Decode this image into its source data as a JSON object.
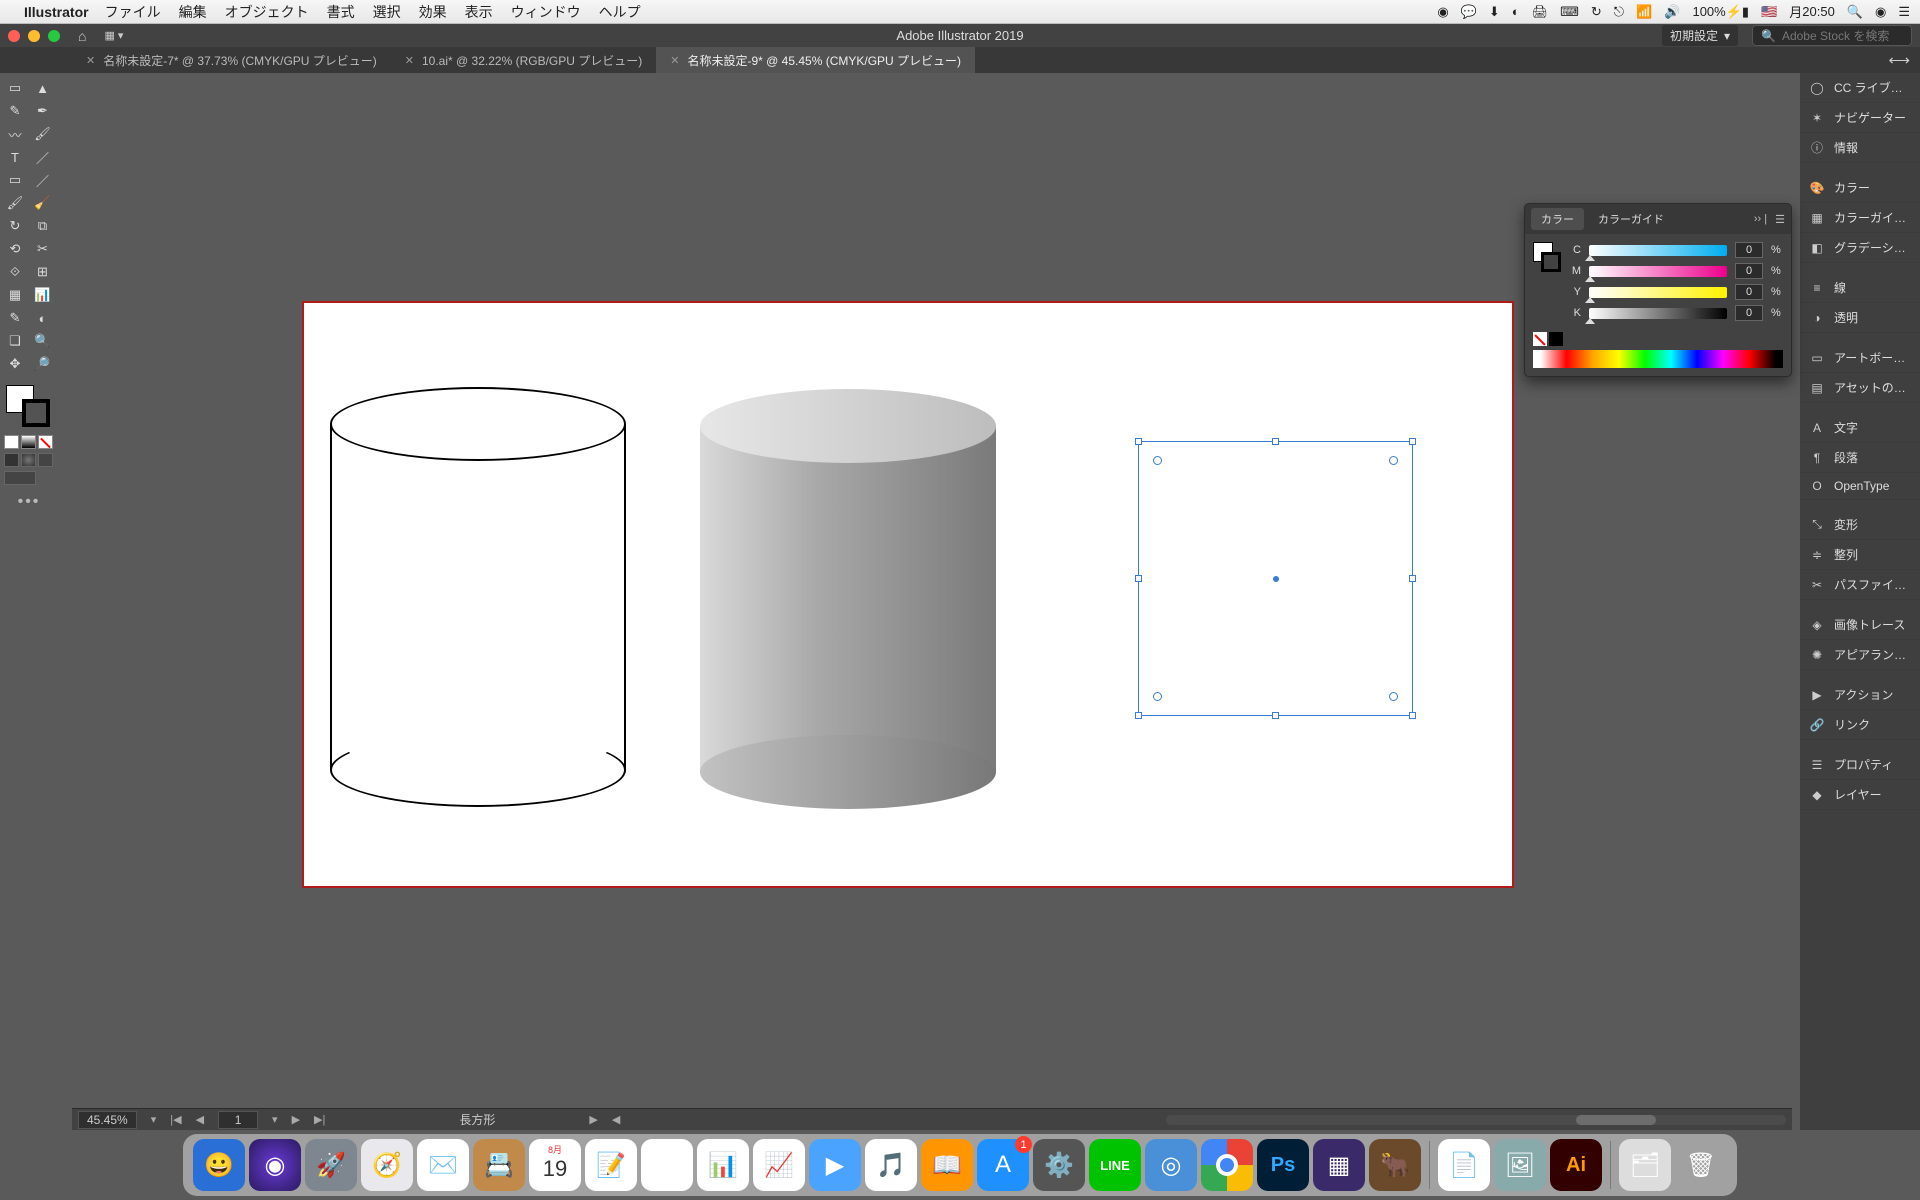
{
  "menubar": {
    "app": "Illustrator",
    "items": [
      "ファイル",
      "編集",
      "オブジェクト",
      "書式",
      "選択",
      "効果",
      "表示",
      "ウィンドウ",
      "ヘルプ"
    ],
    "battery": "100%",
    "lang": "🇺🇸",
    "day": "月",
    "time": "20:50"
  },
  "appstrip": {
    "title": "Adobe Illustrator 2019",
    "workspace": "初期設定",
    "search_placeholder": "Adobe Stock を検索"
  },
  "tabs": [
    {
      "label": "名称未設定-7* @ 37.73% (CMYK/GPU プレビュー)",
      "active": false
    },
    {
      "label": "10.ai* @ 32.22% (RGB/GPU プレビュー)",
      "active": false
    },
    {
      "label": "名称未設定-9* @ 45.45% (CMYK/GPU プレビュー)",
      "active": true
    }
  ],
  "status": {
    "zoom": "45.45%",
    "artboard_nav": "1",
    "object": "長方形"
  },
  "color_panel": {
    "tab_color": "カラー",
    "tab_guide": "カラーガイド",
    "channels": [
      {
        "l": "C",
        "v": "0"
      },
      {
        "l": "M",
        "v": "0"
      },
      {
        "l": "Y",
        "v": "0"
      },
      {
        "l": "K",
        "v": "0"
      }
    ],
    "pct": "%"
  },
  "right_panels": [
    {
      "icon": "◯",
      "label": "CC ライブ…"
    },
    {
      "icon": "✶",
      "label": "ナビゲーター"
    },
    {
      "icon": "ⓘ",
      "label": "情報"
    },
    {
      "sep": true
    },
    {
      "icon": "🎨",
      "label": "カラー"
    },
    {
      "icon": "▦",
      "label": "カラーガイ…"
    },
    {
      "icon": "◧",
      "label": "グラデーシ…"
    },
    {
      "sep": true
    },
    {
      "icon": "≡",
      "label": "線"
    },
    {
      "icon": "◑",
      "label": "透明"
    },
    {
      "sep": true
    },
    {
      "icon": "▭",
      "label": "アートボー…"
    },
    {
      "icon": "▤",
      "label": "アセットの…"
    },
    {
      "sep": true
    },
    {
      "icon": "A",
      "label": "文字"
    },
    {
      "icon": "¶",
      "label": "段落"
    },
    {
      "icon": "O",
      "label": "OpenType"
    },
    {
      "sep": true
    },
    {
      "icon": "⤡",
      "label": "変形"
    },
    {
      "icon": "≑",
      "label": "整列"
    },
    {
      "icon": "✂",
      "label": "パスファイ…"
    },
    {
      "sep": true
    },
    {
      "icon": "◈",
      "label": "画像トレース"
    },
    {
      "icon": "✺",
      "label": "アピアラン…"
    },
    {
      "sep": true
    },
    {
      "icon": "▶",
      "label": "アクション"
    },
    {
      "icon": "🔗",
      "label": "リンク"
    },
    {
      "sep": true
    },
    {
      "icon": "☰",
      "label": "プロパティ"
    },
    {
      "icon": "◆",
      "label": "レイヤー"
    }
  ],
  "tools_left": [
    "▭",
    "▲",
    "✎",
    "✒",
    "〰",
    "🖌",
    "T",
    "／",
    "▭",
    "／",
    "🖌",
    "🧹",
    "↻",
    "⧉",
    "⟲",
    "✂",
    "⟐",
    "⊞",
    "▦",
    "📊",
    "✎",
    "◐",
    "❏",
    "🔍",
    "✥",
    "🔎"
  ],
  "dock": [
    {
      "c": "#2a6fd6",
      "t": "😀",
      "n": "finder"
    },
    {
      "c": "radial-gradient(circle,#6a3bd6,#2a1a60)",
      "t": "◉",
      "n": "siri"
    },
    {
      "c": "#7e8690",
      "t": "🚀",
      "n": "launchpad"
    },
    {
      "c": "#e8e8ed",
      "t": "🧭",
      "n": "safari"
    },
    {
      "c": "#fff",
      "t": "✉️",
      "n": "mail"
    },
    {
      "c": "#c28a4a",
      "t": "📇",
      "n": "contacts"
    },
    {
      "c": "#fff",
      "t": "19",
      "n": "calendar",
      "txt": true,
      "top": "8月"
    },
    {
      "c": "#fff",
      "t": "📝",
      "n": "notes"
    },
    {
      "c": "#fff",
      "t": "🗺",
      "n": "maps"
    },
    {
      "c": "#fff",
      "t": "📊",
      "n": "keynote"
    },
    {
      "c": "#fff",
      "t": "📈",
      "n": "numbers"
    },
    {
      "c": "#4aa3ff",
      "t": "▶",
      "n": "keynote2"
    },
    {
      "c": "#fff",
      "t": "🎵",
      "n": "itunes"
    },
    {
      "c": "#ff9500",
      "t": "📖",
      "n": "ibooks"
    },
    {
      "c": "#1e90ff",
      "t": "A",
      "n": "appstore",
      "badge": "1"
    },
    {
      "c": "#555",
      "t": "⚙️",
      "n": "settings"
    },
    {
      "c": "#00c300",
      "t": "LINE",
      "n": "line",
      "small": true
    },
    {
      "c": "#4a90d9",
      "t": "◎",
      "n": "quicktime"
    },
    {
      "c": "#fff",
      "t": "",
      "n": "chrome",
      "chrome": true
    },
    {
      "c": "#001e36",
      "t": "Ps",
      "n": "photoshop"
    },
    {
      "c": "#3a2a6a",
      "t": "▦",
      "n": "app1"
    },
    {
      "c": "#6a4a2a",
      "t": "🐂",
      "n": "app2"
    }
  ],
  "dock_right": [
    {
      "c": "#fff",
      "t": "📄",
      "n": "textedit"
    },
    {
      "c": "#8aa",
      "t": "🖼",
      "n": "preview"
    },
    {
      "c": "#330000",
      "t": "Ai",
      "n": "illustrator",
      "active": true
    }
  ],
  "dock_far": [
    {
      "c": "#ddd",
      "t": "🗂",
      "n": "downloads"
    },
    {
      "c": "transparent",
      "t": "🗑",
      "n": "trash"
    }
  ]
}
